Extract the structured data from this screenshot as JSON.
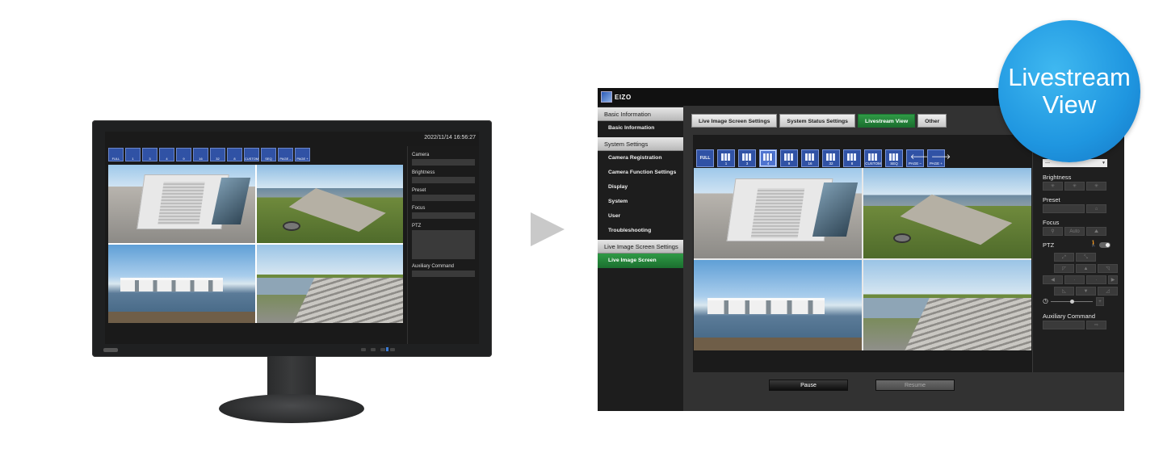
{
  "viewer": {
    "datetime": "2022/11/14 16:56:27",
    "toolbar": [
      {
        "label": "FULL",
        "kind": "full"
      },
      {
        "label": "1"
      },
      {
        "label": "3"
      },
      {
        "label": "4",
        "selected": true
      },
      {
        "label": "9"
      },
      {
        "label": "16"
      },
      {
        "label": "32"
      },
      {
        "label": "8"
      },
      {
        "label": "CUSTOM"
      },
      {
        "label": "SEQ"
      },
      {
        "label": "PAGE –",
        "kind": "arrow",
        "glyph": "🡐"
      },
      {
        "label": "PAGE +",
        "kind": "arrow",
        "glyph": "🡒"
      }
    ],
    "side": {
      "camera_label": "Camera",
      "camera_value": "---",
      "brightness_label": "Brightness",
      "preset_label": "Preset",
      "focus_label": "Focus",
      "focus_mid": "Auto",
      "ptz_label": "PTZ",
      "aux_label": "Auxiliary Command"
    }
  },
  "app": {
    "logo_text": "EIZO",
    "nav": [
      {
        "section": "Basic Information",
        "items": [
          "Basic Information"
        ]
      },
      {
        "section": "System Settings",
        "items": [
          "Camera Registration",
          "Camera Function Settings",
          "Display",
          "System",
          "User",
          "Troubleshooting"
        ]
      },
      {
        "section": "Live Image Screen Settings",
        "items": [
          "Live Image Screen"
        ]
      }
    ],
    "active_nav": "Live Image Screen",
    "tabs": [
      "Live Image Screen Settings",
      "System Status Settings",
      "Livestream View",
      "Other"
    ],
    "active_tab": "Livestream View",
    "pause_label": "Pause",
    "resume_label": "Resume"
  },
  "badge": {
    "line1": "Livestream",
    "line2": "View"
  },
  "colors": {
    "accent_green": "#2f9a46",
    "toolbar_blue": "#3052a5",
    "badge_blue": "#1f96e0"
  }
}
